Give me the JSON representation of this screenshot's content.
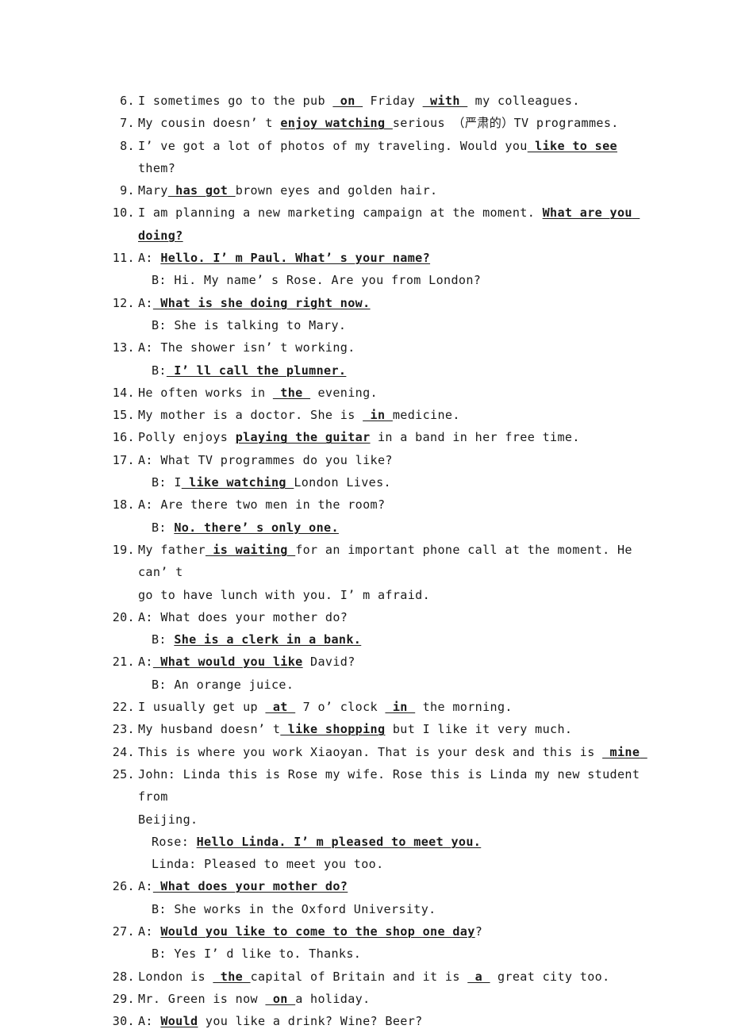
{
  "document": {
    "type": "english-grammar-answer-key",
    "page_background": "#ffffff",
    "text_color": "#1a1a1a",
    "answer_style": "bold-underline"
  },
  "items": [
    {
      "number": "6.",
      "lines": [
        {
          "kind": "main",
          "speaker": "",
          "parts": [
            {
              "t": "I sometimes go to the pub ",
              "a": false
            },
            {
              "t": " on ",
              "a": true
            },
            {
              "t": " Friday ",
              "a": false
            },
            {
              "t": " with ",
              "a": true
            },
            {
              "t": " my colleagues.",
              "a": false
            }
          ]
        }
      ]
    },
    {
      "number": "7.",
      "lines": [
        {
          "kind": "main",
          "speaker": "",
          "parts": [
            {
              "t": "My cousin doesn’ t ",
              "a": false
            },
            {
              "t": "enjoy watching ",
              "a": true
            },
            {
              "t": "serious （严肃的）TV programmes.",
              "a": false
            }
          ]
        }
      ]
    },
    {
      "number": "8.",
      "lines": [
        {
          "kind": "main",
          "speaker": "",
          "parts": [
            {
              "t": "I’ ve got a lot of photos of my traveling. Would you",
              "a": false
            },
            {
              "t": " like to see",
              "a": true
            },
            {
              "t": " them?",
              "a": false
            }
          ]
        }
      ]
    },
    {
      "number": "9.",
      "lines": [
        {
          "kind": "main",
          "speaker": "",
          "parts": [
            {
              "t": "Mary",
              "a": false
            },
            {
              "t": " has got ",
              "a": true
            },
            {
              "t": "brown eyes and golden hair.",
              "a": false
            }
          ]
        }
      ]
    },
    {
      "number": "10.",
      "lines": [
        {
          "kind": "main",
          "speaker": "",
          "parts": [
            {
              "t": "I am planning a new marketing campaign at the moment. ",
              "a": false
            },
            {
              "t": "What are you doing?",
              "a": true
            }
          ]
        }
      ]
    },
    {
      "number": "11.",
      "lines": [
        {
          "kind": "main",
          "speaker": "A: ",
          "parts": [
            {
              "t": "Hello. I’ m Paul. What’ s your name?",
              "a": true
            }
          ]
        },
        {
          "kind": "sub",
          "speaker": "B: ",
          "parts": [
            {
              "t": "Hi. My name’ s Rose. Are you from London?",
              "a": false
            }
          ]
        }
      ]
    },
    {
      "number": "12.",
      "lines": [
        {
          "kind": "main",
          "speaker": "A:",
          "parts": [
            {
              "t": " What is she doing right now.",
              "a": true
            }
          ]
        },
        {
          "kind": "sub",
          "speaker": "B: ",
          "parts": [
            {
              "t": "She is talking to Mary.",
              "a": false
            }
          ]
        }
      ]
    },
    {
      "number": "13.",
      "lines": [
        {
          "kind": "main",
          "speaker": "A: ",
          "parts": [
            {
              "t": "The shower isn’ t working.",
              "a": false
            }
          ]
        },
        {
          "kind": "sub",
          "speaker": "B:",
          "parts": [
            {
              "t": " I’ ll call the plumner.",
              "a": true
            }
          ]
        }
      ]
    },
    {
      "number": "14.",
      "lines": [
        {
          "kind": "main",
          "speaker": "",
          "parts": [
            {
              "t": "He often works in ",
              "a": false
            },
            {
              "t": " the ",
              "a": true
            },
            {
              "t": " evening.",
              "a": false
            }
          ]
        }
      ]
    },
    {
      "number": "15.",
      "lines": [
        {
          "kind": "main",
          "speaker": "",
          "parts": [
            {
              "t": "My mother is a doctor. She is ",
              "a": false
            },
            {
              "t": " in ",
              "a": true
            },
            {
              "t": "medicine.",
              "a": false
            }
          ]
        }
      ]
    },
    {
      "number": "16.",
      "lines": [
        {
          "kind": "main",
          "speaker": "",
          "parts": [
            {
              "t": "Polly enjoys ",
              "a": false
            },
            {
              "t": "playing the guitar",
              "a": true
            },
            {
              "t": " in a band in her free time.",
              "a": false
            }
          ]
        }
      ]
    },
    {
      "number": "17.",
      "lines": [
        {
          "kind": "main",
          "speaker": "A: ",
          "parts": [
            {
              "t": "What TV programmes do you like?",
              "a": false
            }
          ]
        },
        {
          "kind": "sub",
          "speaker": "B: ",
          "parts": [
            {
              "t": "I",
              "a": false
            },
            {
              "t": " like watching ",
              "a": true
            },
            {
              "t": "London Lives.",
              "a": false
            }
          ]
        }
      ]
    },
    {
      "number": "18.",
      "lines": [
        {
          "kind": "main",
          "speaker": "A: ",
          "parts": [
            {
              "t": "Are there two men in the room?",
              "a": false
            }
          ]
        },
        {
          "kind": "sub",
          "speaker": "B: ",
          "parts": [
            {
              "t": "No. there’ s only one.",
              "a": true
            }
          ]
        }
      ]
    },
    {
      "number": "19.",
      "lines": [
        {
          "kind": "main",
          "speaker": "",
          "parts": [
            {
              "t": "My father",
              "a": false
            },
            {
              "t": " is waiting ",
              "a": true
            },
            {
              "t": "for an important phone call at the moment. He can’ t",
              "a": false
            }
          ]
        },
        {
          "kind": "cont",
          "speaker": "",
          "parts": [
            {
              "t": "go to have lunch with you. I’ m afraid.",
              "a": false
            }
          ]
        }
      ]
    },
    {
      "number": "20.",
      "lines": [
        {
          "kind": "main",
          "speaker": "A: ",
          "parts": [
            {
              "t": "What does your mother do?",
              "a": false
            }
          ]
        },
        {
          "kind": "sub",
          "speaker": "B: ",
          "parts": [
            {
              "t": "She is a clerk in a bank.",
              "a": true
            }
          ]
        }
      ]
    },
    {
      "number": "21.",
      "lines": [
        {
          "kind": "main",
          "speaker": "A:",
          "parts": [
            {
              "t": " What would you like",
              "a": true
            },
            {
              "t": " David?",
              "a": false
            }
          ]
        },
        {
          "kind": "sub",
          "speaker": "B: ",
          "parts": [
            {
              "t": "An orange juice.",
              "a": false
            }
          ]
        }
      ]
    },
    {
      "number": "22.",
      "lines": [
        {
          "kind": "main",
          "speaker": "",
          "parts": [
            {
              "t": "I usually get up ",
              "a": false
            },
            {
              "t": " at ",
              "a": true
            },
            {
              "t": " 7 o’ clock ",
              "a": false
            },
            {
              "t": " in ",
              "a": true
            },
            {
              "t": " the morning.",
              "a": false
            }
          ]
        }
      ]
    },
    {
      "number": "23.",
      "lines": [
        {
          "kind": "main",
          "speaker": "",
          "parts": [
            {
              "t": "My husband doesn’ t",
              "a": false
            },
            {
              "t": " like shopping",
              "a": true
            },
            {
              "t": " but I like it very much.",
              "a": false
            }
          ]
        }
      ]
    },
    {
      "number": "24.",
      "lines": [
        {
          "kind": "main",
          "speaker": "",
          "parts": [
            {
              "t": "This is where you work Xiaoyan. That is your desk and this is ",
              "a": false
            },
            {
              "t": " mine ",
              "a": true
            }
          ]
        }
      ]
    },
    {
      "number": "25.",
      "lines": [
        {
          "kind": "main",
          "speaker": "",
          "parts": [
            {
              "t": "John: Linda this is Rose my wife. Rose this is Linda my new student from",
              "a": false
            }
          ]
        },
        {
          "kind": "cont",
          "speaker": "",
          "parts": [
            {
              "t": "Beijing.",
              "a": false
            }
          ]
        },
        {
          "kind": "sub",
          "speaker": "Rose: ",
          "parts": [
            {
              "t": "Hello Linda. I’ m pleased to meet you.",
              "a": true
            }
          ]
        },
        {
          "kind": "sub",
          "speaker": "Linda: ",
          "parts": [
            {
              "t": "Pleased to meet you too.",
              "a": false
            }
          ]
        }
      ]
    },
    {
      "number": "26.",
      "lines": [
        {
          "kind": "main",
          "speaker": "A:",
          "parts": [
            {
              "t": " What does your mother do?",
              "a": true
            }
          ]
        },
        {
          "kind": "sub",
          "speaker": "B: ",
          "parts": [
            {
              "t": "She works in the Oxford University.",
              "a": false
            }
          ]
        }
      ]
    },
    {
      "number": "27.",
      "lines": [
        {
          "kind": "main",
          "speaker": "A: ",
          "parts": [
            {
              "t": "Would you like to come to the shop one day",
              "a": true
            },
            {
              "t": "?",
              "a": false
            }
          ]
        },
        {
          "kind": "sub",
          "speaker": "B: ",
          "parts": [
            {
              "t": "Yes I’ d like to. Thanks.",
              "a": false
            }
          ]
        }
      ]
    },
    {
      "number": "28.",
      "lines": [
        {
          "kind": "main",
          "speaker": "",
          "parts": [
            {
              "t": "London is ",
              "a": false
            },
            {
              "t": " the ",
              "a": true
            },
            {
              "t": "capital of Britain and it is ",
              "a": false
            },
            {
              "t": " a ",
              "a": true
            },
            {
              "t": " great city too.",
              "a": false
            }
          ]
        }
      ]
    },
    {
      "number": "29.",
      "lines": [
        {
          "kind": "main",
          "speaker": "",
          "parts": [
            {
              "t": "Mr. Green is now ",
              "a": false
            },
            {
              "t": " on ",
              "a": true
            },
            {
              "t": "a holiday.",
              "a": false
            }
          ]
        }
      ]
    },
    {
      "number": "30.",
      "lines": [
        {
          "kind": "main",
          "speaker": "A: ",
          "parts": [
            {
              "t": "Would",
              "a": true
            },
            {
              "t": " you like a drink? Wine? Beer?",
              "a": false
            }
          ]
        }
      ]
    }
  ]
}
